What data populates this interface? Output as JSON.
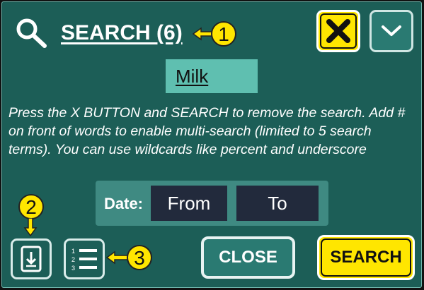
{
  "header": {
    "title": "SEARCH (6)"
  },
  "search": {
    "value": "Milk"
  },
  "help_text": "Press the X BUTTON and SEARCH to remove the search. Add # on front of words to enable multi-search (limited to 5 search terms). You can use wildcards like percent and underscore",
  "date_filter": {
    "label": "Date:",
    "from_label": "From",
    "to_label": "To"
  },
  "buttons": {
    "close_label": "CLOSE",
    "search_label": "SEARCH"
  },
  "callouts": {
    "one": "1",
    "two": "2",
    "three": "3"
  },
  "icons": {
    "search": "search-icon",
    "clear": "x-icon",
    "expand": "chevron-down-icon",
    "download": "download-icon",
    "list": "numbered-list-icon"
  },
  "colors": {
    "panel_bg": "#1c5e57",
    "accent_yellow": "#ffe600",
    "field_bg": "#5fbfb0",
    "date_input_bg": "#222a3c"
  }
}
